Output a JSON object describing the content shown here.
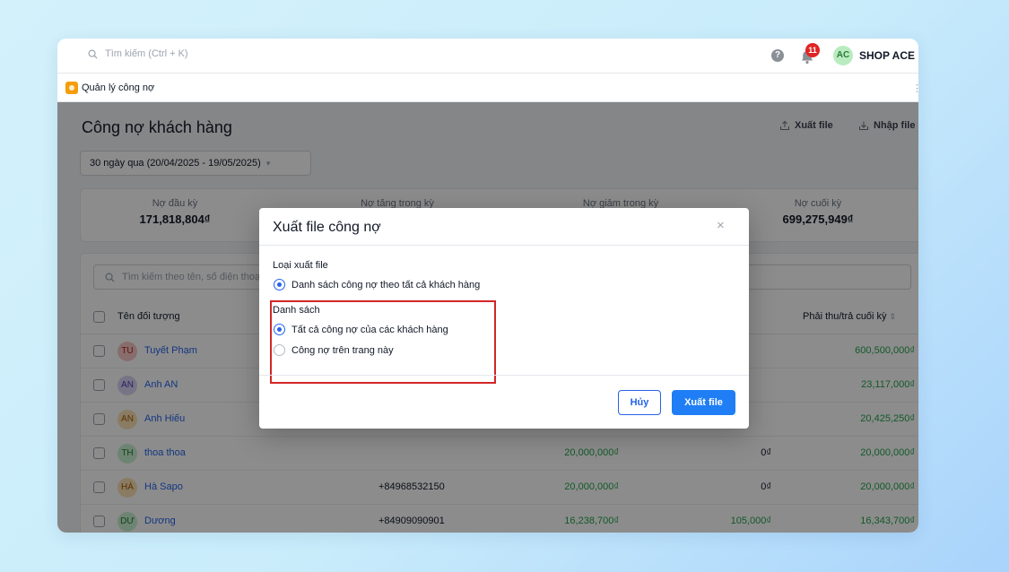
{
  "topbar": {
    "search_placeholder": "Tìm kiếm (Ctrl + K)",
    "help_label": "?",
    "notification_count": "11",
    "avatar_initials": "AC",
    "shop_name": "SHOP ACE"
  },
  "tab": {
    "label": "Quản lý công nợ"
  },
  "page": {
    "title": "Công nợ khách hàng",
    "export_label": "Xuất file",
    "import_label": "Nhập file",
    "date_filter": "30 ngày qua (20/04/2025 - 19/05/2025)",
    "summary": [
      {
        "label": "Nợ đầu kỳ",
        "value": "171,818,804₫"
      },
      {
        "label": "Nợ tăng trong kỳ",
        "value": ""
      },
      {
        "label": "Nợ giảm trong kỳ",
        "value": ""
      },
      {
        "label": "Nợ cuối kỳ",
        "value": "699,275,949₫"
      }
    ],
    "list_search_placeholder": "Tìm kiếm theo tên, số điện thoại",
    "columns": {
      "name": "Tên đối tượng",
      "end_balance": "Phải thu/trả cuối kỳ"
    },
    "rows": [
      {
        "initials": "TU",
        "name": "Tuyết Phạm",
        "phone": "",
        "debt_up": "",
        "debt_down": "",
        "end": "600,500,000₫"
      },
      {
        "initials": "AN",
        "name": "Anh AN",
        "phone": "",
        "debt_up": "",
        "debt_down": "",
        "end": "23,117,000₫"
      },
      {
        "initials": "AN",
        "name": "Anh Hiếu",
        "phone": "",
        "debt_up": "",
        "debt_down": "",
        "end": "20,425,250₫"
      },
      {
        "initials": "TH",
        "name": "thoa thoa",
        "phone": "",
        "debt_up": "20,000,000₫",
        "debt_down": "0₫",
        "end": "20,000,000₫"
      },
      {
        "initials": "HÀ",
        "name": "Hà Sapo",
        "phone": "+84968532150",
        "debt_up": "20,000,000₫",
        "debt_down": "0₫",
        "end": "20,000,000₫"
      },
      {
        "initials": "DƯ",
        "name": "Dương",
        "phone": "+84909090901",
        "debt_up": "16,238,700₫",
        "debt_down": "105,000₫",
        "end": "16,343,700₫"
      }
    ]
  },
  "modal": {
    "title": "Xuất file công nợ",
    "close_label": "×",
    "export_type_label": "Loại xuất file",
    "export_type_option": "Danh sách công nợ theo tất cả khách hàng",
    "list_label": "Danh sách",
    "list_options": [
      "Tất cả công nợ của các khách hàng",
      "Công nợ trên trang này"
    ],
    "cancel_label": "Hủy",
    "export_label": "Xuất file"
  },
  "colors": {
    "accent": "#1f7ef5",
    "link": "#2563eb",
    "positive": "#22a34a",
    "highlight": "#d32626"
  }
}
